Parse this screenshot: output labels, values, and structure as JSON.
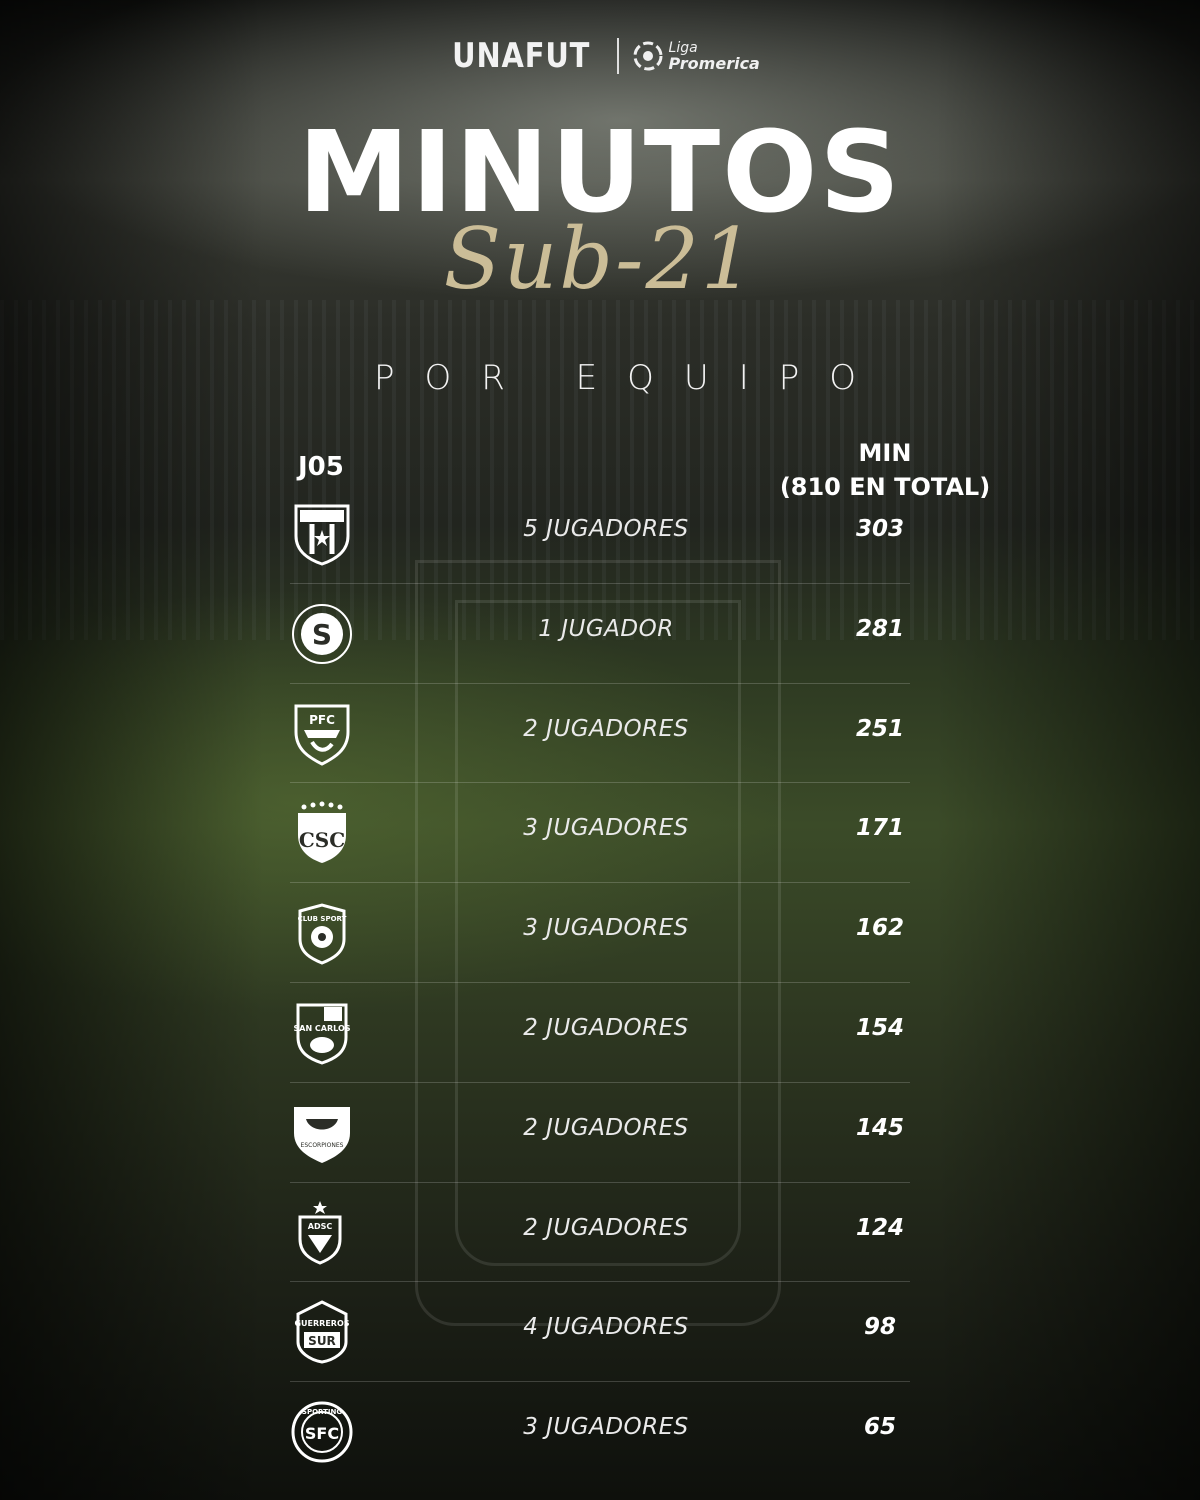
{
  "header": {
    "brand": "UNAFUT",
    "league_line1": "Liga",
    "league_line2": "Promerica"
  },
  "title": "MINUTOS",
  "subtitle": "Sub-21",
  "section": "POR EQUIPO",
  "table": {
    "round_label": "J05",
    "minutes_header_line1": "MIN",
    "minutes_header_line2": "(810 EN TOTAL)",
    "rows": [
      {
        "crest": "lda-crest-icon",
        "crest_text": "L D A",
        "players": "5 JUGADORES",
        "minutes": "303"
      },
      {
        "crest": "saprissa-crest-icon",
        "crest_text": "S",
        "players": "1 JUGADOR",
        "minutes": "281"
      },
      {
        "crest": "puntarenas-crest-icon",
        "crest_text": "PFC",
        "players": "2 JUGADORES",
        "minutes": "251"
      },
      {
        "crest": "cartagines-crest-icon",
        "crest_text": "CSC",
        "players": "3 JUGADORES",
        "minutes": "171"
      },
      {
        "crest": "herediano-crest-icon",
        "crest_text": "CLUB SPORT",
        "players": "3 JUGADORES",
        "minutes": "162"
      },
      {
        "crest": "san-carlos-crest-icon",
        "crest_text": "SAN CARLOS",
        "players": "2 JUGADORES",
        "minutes": "154"
      },
      {
        "crest": "escorpiones-crest-icon",
        "crest_text": "ESCORPIONES",
        "players": "2 JUGADORES",
        "minutes": "145"
      },
      {
        "crest": "adsc-crest-icon",
        "crest_text": "ADSC",
        "players": "2 JUGADORES",
        "minutes": "124"
      },
      {
        "crest": "guerreros-del-sur-crest-icon",
        "crest_text": "GUERREROS SUR",
        "players": "4 JUGADORES",
        "minutes": "98"
      },
      {
        "crest": "sporting-fc-crest-icon",
        "crest_text": "SPORTING",
        "players": "3 JUGADORES",
        "minutes": "65"
      }
    ]
  },
  "colors": {
    "accent_gold": "#cbbd97",
    "text": "#ffffff"
  }
}
